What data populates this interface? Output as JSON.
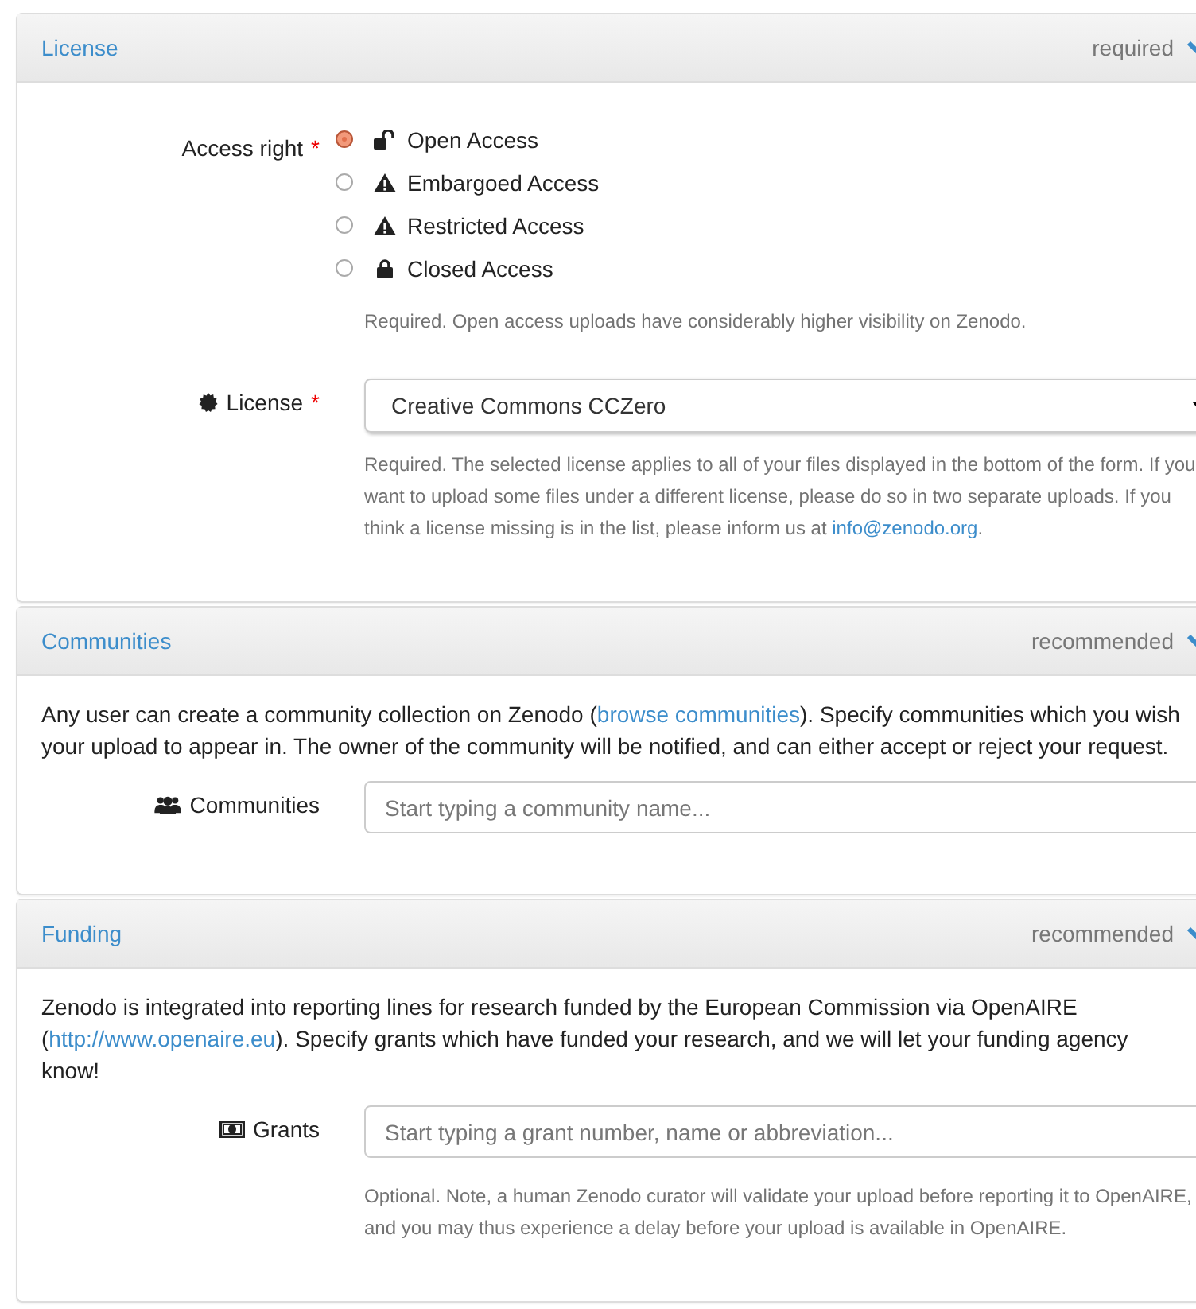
{
  "panels": [
    {
      "title": "License",
      "tag": "required",
      "expanded": true,
      "fields": [
        {
          "kind": "radio",
          "label": "Access right",
          "required_mark": "*",
          "options": [
            {
              "label": "Open Access",
              "kind": "open",
              "selected": true
            },
            {
              "label": "Embargoed Access",
              "kind": "embargoed",
              "selected": false
            },
            {
              "label": "Restricted Access",
              "kind": "restricted",
              "selected": false
            },
            {
              "label": "Closed Access",
              "kind": "closed",
              "selected": false
            }
          ],
          "help": [
            {
              "kind": "text",
              "text": "Required. Open access uploads have considerably higher visibility on Zenodo."
            }
          ]
        },
        {
          "kind": "select",
          "label": "License",
          "required_mark": "*",
          "value": "Creative Commons CCZero",
          "help": [
            {
              "kind": "text",
              "text": "Required. The selected license applies to all of your files displayed in the bottom of the form. If you want to upload some files under a different license, please do so in two separate uploads. If you think a license missing is in the list, please inform us at "
            },
            {
              "kind": "link",
              "text": "info@zenodo.org"
            },
            {
              "kind": "text",
              "text": "."
            }
          ]
        }
      ]
    },
    {
      "title": "Communities",
      "tag": "recommended",
      "expanded": true,
      "intro": [
        {
          "kind": "text",
          "text": "Any user can create a community collection on Zenodo ("
        },
        {
          "kind": "link",
          "text": "browse communities"
        },
        {
          "kind": "text",
          "text": "). Specify communities which you wish your upload to appear in. The owner of the community will be notified, and can either accept or reject your request."
        }
      ],
      "fields": [
        {
          "kind": "input",
          "label": "Communities",
          "placeholder": "Start typing a community name..."
        }
      ]
    },
    {
      "title": "Funding",
      "tag": "recommended",
      "expanded": true,
      "intro": [
        {
          "kind": "text",
          "text": "Zenodo is integrated into reporting lines for research funded by the European Commission via OpenAIRE ("
        },
        {
          "kind": "link",
          "text": "http://www.openaire.eu"
        },
        {
          "kind": "text",
          "text": "). Specify grants which have funded your research, and we will let your funding agency know!"
        }
      ],
      "fields": [
        {
          "kind": "input",
          "label": "Grants",
          "placeholder": "Start typing a grant number, name or abbreviation...",
          "help": [
            {
              "kind": "text",
              "text": "Optional. Note, a human Zenodo curator will validate your upload before reporting it to OpenAIRE, and you may thus experience a delay before your upload is available in OpenAIRE."
            }
          ]
        }
      ]
    }
  ]
}
